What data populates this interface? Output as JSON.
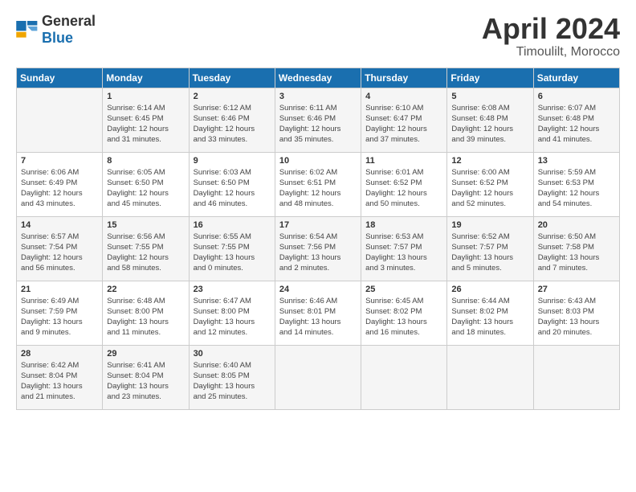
{
  "header": {
    "logo_general": "General",
    "logo_blue": "Blue",
    "title": "April 2024",
    "location": "Timoulilt, Morocco"
  },
  "days_of_week": [
    "Sunday",
    "Monday",
    "Tuesday",
    "Wednesday",
    "Thursday",
    "Friday",
    "Saturday"
  ],
  "weeks": [
    [
      {
        "day": "",
        "info": ""
      },
      {
        "day": "1",
        "info": "Sunrise: 6:14 AM\nSunset: 6:45 PM\nDaylight: 12 hours\nand 31 minutes."
      },
      {
        "day": "2",
        "info": "Sunrise: 6:12 AM\nSunset: 6:46 PM\nDaylight: 12 hours\nand 33 minutes."
      },
      {
        "day": "3",
        "info": "Sunrise: 6:11 AM\nSunset: 6:46 PM\nDaylight: 12 hours\nand 35 minutes."
      },
      {
        "day": "4",
        "info": "Sunrise: 6:10 AM\nSunset: 6:47 PM\nDaylight: 12 hours\nand 37 minutes."
      },
      {
        "day": "5",
        "info": "Sunrise: 6:08 AM\nSunset: 6:48 PM\nDaylight: 12 hours\nand 39 minutes."
      },
      {
        "day": "6",
        "info": "Sunrise: 6:07 AM\nSunset: 6:48 PM\nDaylight: 12 hours\nand 41 minutes."
      }
    ],
    [
      {
        "day": "7",
        "info": "Sunrise: 6:06 AM\nSunset: 6:49 PM\nDaylight: 12 hours\nand 43 minutes."
      },
      {
        "day": "8",
        "info": "Sunrise: 6:05 AM\nSunset: 6:50 PM\nDaylight: 12 hours\nand 45 minutes."
      },
      {
        "day": "9",
        "info": "Sunrise: 6:03 AM\nSunset: 6:50 PM\nDaylight: 12 hours\nand 46 minutes."
      },
      {
        "day": "10",
        "info": "Sunrise: 6:02 AM\nSunset: 6:51 PM\nDaylight: 12 hours\nand 48 minutes."
      },
      {
        "day": "11",
        "info": "Sunrise: 6:01 AM\nSunset: 6:52 PM\nDaylight: 12 hours\nand 50 minutes."
      },
      {
        "day": "12",
        "info": "Sunrise: 6:00 AM\nSunset: 6:52 PM\nDaylight: 12 hours\nand 52 minutes."
      },
      {
        "day": "13",
        "info": "Sunrise: 5:59 AM\nSunset: 6:53 PM\nDaylight: 12 hours\nand 54 minutes."
      }
    ],
    [
      {
        "day": "14",
        "info": "Sunrise: 6:57 AM\nSunset: 7:54 PM\nDaylight: 12 hours\nand 56 minutes."
      },
      {
        "day": "15",
        "info": "Sunrise: 6:56 AM\nSunset: 7:55 PM\nDaylight: 12 hours\nand 58 minutes."
      },
      {
        "day": "16",
        "info": "Sunrise: 6:55 AM\nSunset: 7:55 PM\nDaylight: 13 hours\nand 0 minutes."
      },
      {
        "day": "17",
        "info": "Sunrise: 6:54 AM\nSunset: 7:56 PM\nDaylight: 13 hours\nand 2 minutes."
      },
      {
        "day": "18",
        "info": "Sunrise: 6:53 AM\nSunset: 7:57 PM\nDaylight: 13 hours\nand 3 minutes."
      },
      {
        "day": "19",
        "info": "Sunrise: 6:52 AM\nSunset: 7:57 PM\nDaylight: 13 hours\nand 5 minutes."
      },
      {
        "day": "20",
        "info": "Sunrise: 6:50 AM\nSunset: 7:58 PM\nDaylight: 13 hours\nand 7 minutes."
      }
    ],
    [
      {
        "day": "21",
        "info": "Sunrise: 6:49 AM\nSunset: 7:59 PM\nDaylight: 13 hours\nand 9 minutes."
      },
      {
        "day": "22",
        "info": "Sunrise: 6:48 AM\nSunset: 8:00 PM\nDaylight: 13 hours\nand 11 minutes."
      },
      {
        "day": "23",
        "info": "Sunrise: 6:47 AM\nSunset: 8:00 PM\nDaylight: 13 hours\nand 12 minutes."
      },
      {
        "day": "24",
        "info": "Sunrise: 6:46 AM\nSunset: 8:01 PM\nDaylight: 13 hours\nand 14 minutes."
      },
      {
        "day": "25",
        "info": "Sunrise: 6:45 AM\nSunset: 8:02 PM\nDaylight: 13 hours\nand 16 minutes."
      },
      {
        "day": "26",
        "info": "Sunrise: 6:44 AM\nSunset: 8:02 PM\nDaylight: 13 hours\nand 18 minutes."
      },
      {
        "day": "27",
        "info": "Sunrise: 6:43 AM\nSunset: 8:03 PM\nDaylight: 13 hours\nand 20 minutes."
      }
    ],
    [
      {
        "day": "28",
        "info": "Sunrise: 6:42 AM\nSunset: 8:04 PM\nDaylight: 13 hours\nand 21 minutes."
      },
      {
        "day": "29",
        "info": "Sunrise: 6:41 AM\nSunset: 8:04 PM\nDaylight: 13 hours\nand 23 minutes."
      },
      {
        "day": "30",
        "info": "Sunrise: 6:40 AM\nSunset: 8:05 PM\nDaylight: 13 hours\nand 25 minutes."
      },
      {
        "day": "",
        "info": ""
      },
      {
        "day": "",
        "info": ""
      },
      {
        "day": "",
        "info": ""
      },
      {
        "day": "",
        "info": ""
      }
    ]
  ]
}
